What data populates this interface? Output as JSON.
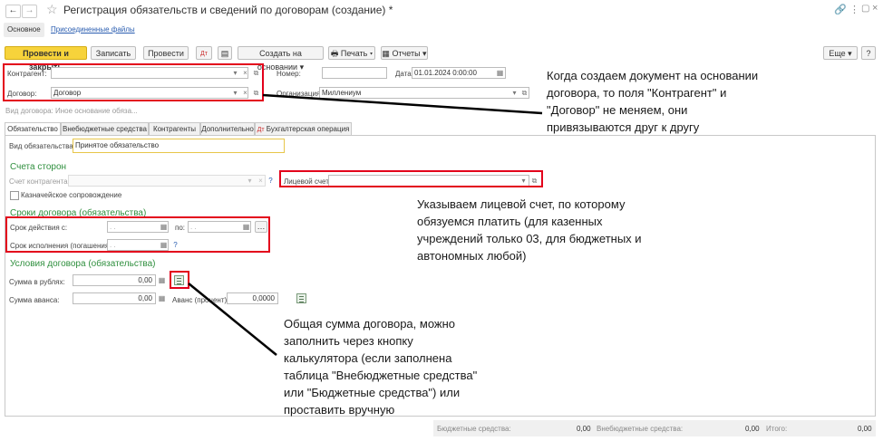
{
  "window": {
    "title": "Регистрация обязательств и сведений по договорам (создание) *",
    "tabs": [
      {
        "label": "Основное"
      },
      {
        "label": "Присоединенные файлы"
      }
    ]
  },
  "toolbar": {
    "post_close": "Провести и закрыть",
    "save": "Записать",
    "post": "Провести",
    "create_based_on": "Создать на основании",
    "print": "Печать",
    "reports": "Отчеты",
    "more": "Еще",
    "help": "?"
  },
  "header": {
    "counterparty_label": "Контрагент:",
    "counterparty_value": "",
    "contract_label": "Договор:",
    "contract_value": "Договор",
    "number_label": "Номер:",
    "number_value": "",
    "date_label": "Дата:",
    "date_value": "01.01.2024  0:00:00",
    "organization_label": "Организация:",
    "organization_value": "Миллениум",
    "basis_link": "Вид договора: Иное основание обяза..."
  },
  "tabs": [
    {
      "label": "Обязательство"
    },
    {
      "label": "Внебюджетные средства"
    },
    {
      "label": "Контрагенты"
    },
    {
      "label": "Дополнительно"
    },
    {
      "label": "Бухгалтерская операция"
    }
  ],
  "obligation": {
    "type_label": "Вид обязательства:",
    "type_value": "Принятое обязательство",
    "accounts_title": "Счета сторон",
    "counterparty_account_label": "Счет контрагента:",
    "personal_account_label": "Лицевой счет:",
    "treasury_label": "Казначейское сопровождение",
    "terms_title": "Сроки договора (обязательства)",
    "valid_from_label": "Срок действия с:",
    "valid_from_value": " .  .",
    "to_label": "по:",
    "to_value": " .  .",
    "execution_label": "Срок исполнения (погашения):",
    "execution_value": " .  .",
    "conditions_title": "Условия договора (обязательства)",
    "sum_label": "Сумма в рублях:",
    "sum_value": "0,00",
    "advance_label": "Сумма аванса:",
    "advance_value": "0,00",
    "advance_pct_label": "Аванс (процент):",
    "advance_pct_value": "0,0000"
  },
  "footer": {
    "budget_label": "Бюджетные средства:",
    "budget_value": "0,00",
    "extrabudget_label": "Внебюджетные средства:",
    "extrabudget_value": "0,00",
    "total_label": "Итого:",
    "total_value": "0,00"
  },
  "annotations": {
    "note1": "Когда создаем документ на основании договора, то поля \"Контрагент\" и \"Договор\" не меняем, они привязываются друг к другу",
    "note2": "Указываем лицевой счет, по которому обязуемся платить (для казенных учреждений только 03, для бюджетных и автономных любой)",
    "note3": "Общая сумма договора, можно заполнить через кнопку калькулятора (если заполнена таблица \"Внебюджетные средства\" или \"Бюджетные средства\") или проставить вручную"
  },
  "colors": {
    "accent_yellow": "#f7d33b",
    "highlight_red": "#e3001b",
    "section_green": "#2f8f3e",
    "link_blue": "#2a5db0"
  }
}
